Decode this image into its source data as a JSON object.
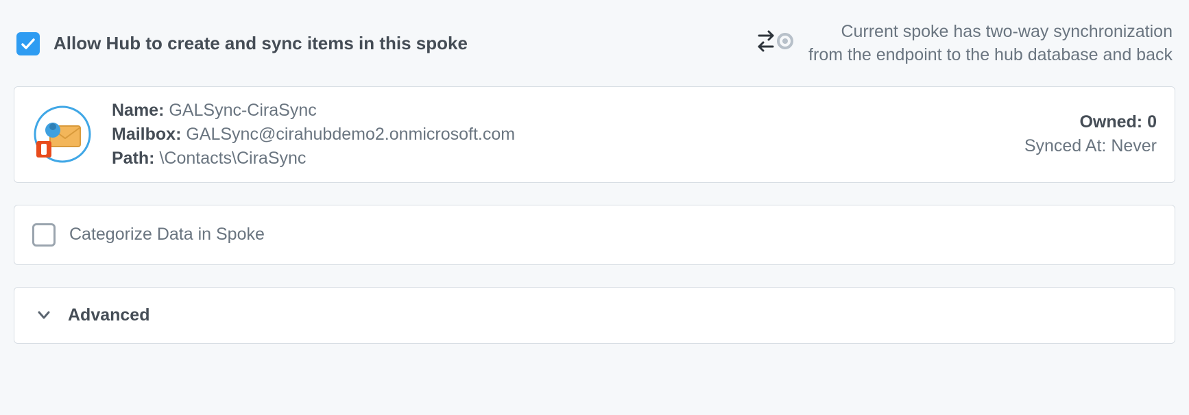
{
  "header": {
    "allow_label": "Allow Hub to create and sync items in this spoke",
    "allow_checked": true,
    "sync_desc_line1": "Current spoke has two-way synchronization",
    "sync_desc_line2": "from the endpoint to the hub database and back"
  },
  "spoke": {
    "name_label": "Name:",
    "name_value": "GALSync-CiraSync",
    "mailbox_label": "Mailbox:",
    "mailbox_value": "GALSync@cirahubdemo2.onmicrosoft.com",
    "path_label": "Path:",
    "path_value": "\\Contacts\\CiraSync",
    "owned_label": "Owned:",
    "owned_value": "0",
    "synced_label": "Synced At:",
    "synced_value": "Never"
  },
  "categorize": {
    "checked": false,
    "label": "Categorize Data in Spoke"
  },
  "advanced": {
    "label": "Advanced"
  }
}
